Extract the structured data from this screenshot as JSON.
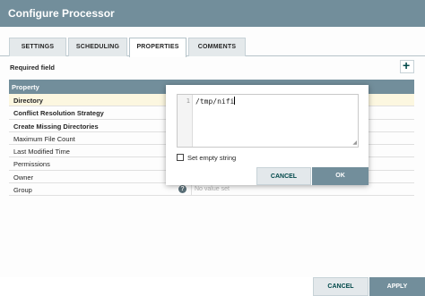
{
  "window": {
    "title": "Configure Processor"
  },
  "tabs": [
    {
      "label": "SETTINGS"
    },
    {
      "label": "SCHEDULING"
    },
    {
      "label": "PROPERTIES"
    },
    {
      "label": "COMMENTS"
    }
  ],
  "active_tab": "PROPERTIES",
  "required_field_label": "Required field",
  "add_icon": "plus-icon",
  "table": {
    "header": "Property",
    "rows": [
      {
        "name": "Directory",
        "required": true
      },
      {
        "name": "Conflict Resolution Strategy",
        "required": true
      },
      {
        "name": "Create Missing Directories",
        "required": true
      },
      {
        "name": "Maximum File Count",
        "required": false
      },
      {
        "name": "Last Modified Time",
        "required": false
      },
      {
        "name": "Permissions",
        "required": false
      },
      {
        "name": "Owner",
        "required": false
      },
      {
        "name": "Group",
        "required": false,
        "value": "No value set"
      }
    ]
  },
  "editor": {
    "line_number": "1",
    "value": "/tmp/nifi",
    "empty_string_label": "Set empty string",
    "empty_string_checked": false,
    "cancel_label": "CANCEL",
    "ok_label": "OK"
  },
  "footer": {
    "cancel_label": "CANCEL",
    "apply_label": "APPLY"
  },
  "colors": {
    "header": "#728e9b",
    "selected_row": "#fcf7e0",
    "accent_text": "#004849"
  }
}
